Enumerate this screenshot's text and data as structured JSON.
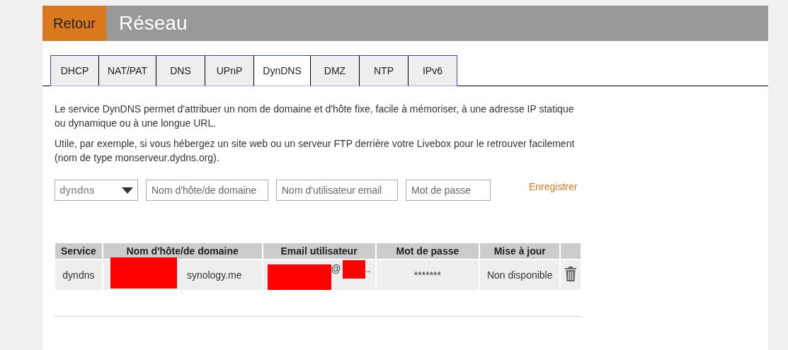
{
  "header": {
    "back_button": "Retour",
    "title": "Réseau"
  },
  "tabs": [
    {
      "label": "DHCP",
      "selected": false
    },
    {
      "label": "NAT/PAT",
      "selected": false
    },
    {
      "label": "DNS",
      "selected": false
    },
    {
      "label": "UPnP",
      "selected": false
    },
    {
      "label": "DynDNS",
      "selected": true
    },
    {
      "label": "DMZ",
      "selected": false
    },
    {
      "label": "NTP",
      "selected": false
    },
    {
      "label": "IPv6",
      "selected": false
    }
  ],
  "paragraphs": [
    "Le service DynDNS permet d'attribuer un nom de domaine et d'hôte fixe, facile à mémoriser, à une adresse IP statique ou dynamique ou à une longue URL.",
    "Utile, par exemple, si vous hébergez un site web ou un serveur FTP derrière votre Livebox pour le retrouver facilement (nom de type monserveur.dydns.org)."
  ],
  "form": {
    "service_select": "dyndns",
    "host_field": {
      "placeholder": "Nom d'hôte/de domaine"
    },
    "user_field": {
      "placeholder": "Nom d'utilisateur email"
    },
    "password_field": {
      "placeholder": "Mot de passe"
    },
    "save_link": "Enregistrer"
  },
  "table": {
    "columns": [
      "Service",
      "Nom d'hôte/de domaine",
      "Email utilisateur",
      "Mot de passe",
      "Mise à jour"
    ],
    "rows": [
      {
        "service": "dyndns",
        "host": "synology.me",
        "email_at": "@",
        "email_tail": "..",
        "password": "*******",
        "update": "Non disponible"
      }
    ]
  }
}
